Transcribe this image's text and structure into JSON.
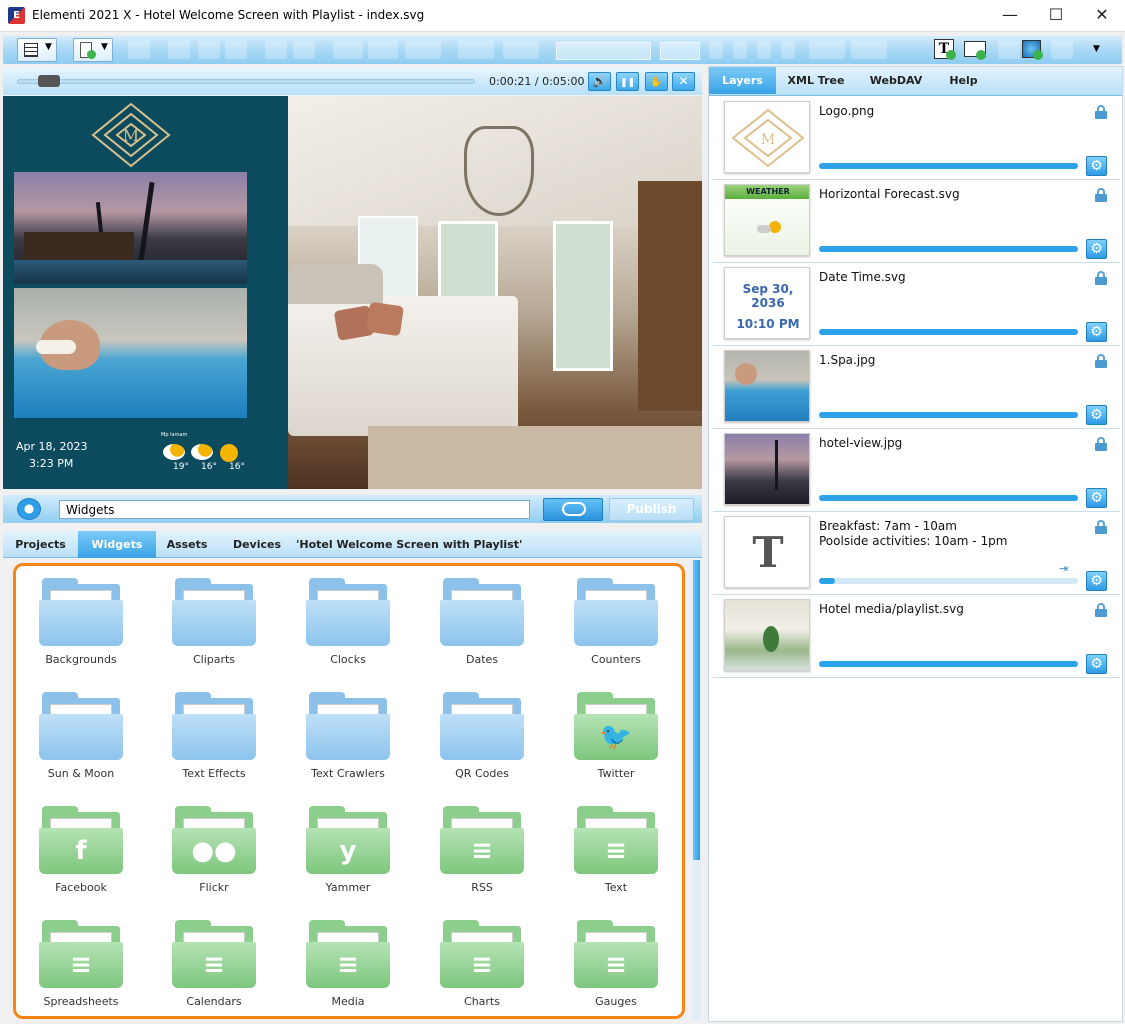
{
  "window": {
    "title": "Elementi 2021 X - Hotel Welcome Screen with Playlist - index.svg",
    "app_icon": "elementi-app-icon",
    "controls": [
      "—",
      "☐",
      "✕"
    ]
  },
  "player": {
    "time": "0:00:21 / 0:05:00",
    "progress_fraction": 0.07,
    "buttons": [
      {
        "name": "volume-icon",
        "glyph": "🔊"
      },
      {
        "name": "pause-icon",
        "glyph": "❚❚"
      },
      {
        "name": "hand-icon",
        "glyph": "✋"
      },
      {
        "name": "close-icon",
        "glyph": "✕"
      }
    ]
  },
  "stage": {
    "date": "Apr 18, 2023",
    "time": "3:23 PM",
    "weather_title": "Mp lamam",
    "temps": [
      "19°",
      "16°",
      "16°"
    ]
  },
  "widget_bar": {
    "search_value": "Widgets",
    "publish_label": "Publish"
  },
  "left_tabs": [
    "Projects",
    "Widgets",
    "Assets",
    "Devices",
    "'Hotel Welcome Screen with Playlist'"
  ],
  "left_active_tab": "Widgets",
  "folders": [
    {
      "label": "Backgrounds",
      "color": "blue",
      "glyph": ""
    },
    {
      "label": "Cliparts",
      "color": "blue",
      "glyph": ""
    },
    {
      "label": "Clocks",
      "color": "blue",
      "glyph": ""
    },
    {
      "label": "Dates",
      "color": "blue",
      "glyph": ""
    },
    {
      "label": "Counters",
      "color": "blue",
      "glyph": ""
    },
    {
      "label": "Sun & Moon",
      "color": "blue",
      "glyph": ""
    },
    {
      "label": "Text Effects",
      "color": "blue",
      "glyph": ""
    },
    {
      "label": "Text Crawlers",
      "color": "blue",
      "glyph": ""
    },
    {
      "label": "QR Codes",
      "color": "blue",
      "glyph": ""
    },
    {
      "label": "Twitter",
      "color": "green",
      "glyph": "🐦"
    },
    {
      "label": "Facebook",
      "color": "green",
      "glyph": "f"
    },
    {
      "label": "Flickr",
      "color": "green",
      "glyph": "●●"
    },
    {
      "label": "Yammer",
      "color": "green",
      "glyph": "y"
    },
    {
      "label": "RSS",
      "color": "green",
      "glyph": "≡"
    },
    {
      "label": "Text",
      "color": "green",
      "glyph": "≡"
    },
    {
      "label": "Spreadsheets",
      "color": "green",
      "glyph": "≡"
    },
    {
      "label": "Calendars",
      "color": "green",
      "glyph": "≡"
    },
    {
      "label": "Media",
      "color": "green",
      "glyph": "≡"
    },
    {
      "label": "Charts",
      "color": "green",
      "glyph": "≡"
    },
    {
      "label": "Gauges",
      "color": "green",
      "glyph": "≡"
    }
  ],
  "right_tabs": [
    "Layers",
    "XML Tree",
    "WebDAV",
    "Help"
  ],
  "right_active_tab": "Layers",
  "layers": [
    {
      "name": "Logo.png",
      "thumb": "logo",
      "progress": 1.0
    },
    {
      "name": "Horizontal Forecast.svg",
      "thumb": "weather",
      "thumb_text": "WEATHER",
      "progress": 1.0
    },
    {
      "name": "Date Time.svg",
      "thumb": "date",
      "thumb_text": "Sep 30, 2036",
      "thumb_text2": "10:10 PM",
      "progress": 1.0
    },
    {
      "name": "1.Spa.jpg",
      "thumb": "spa",
      "progress": 1.0
    },
    {
      "name": "hotel-view.jpg",
      "thumb": "hotel",
      "progress": 1.0
    },
    {
      "name": "Breakfast: 7am - 10am\nPoolside activities: 10am - 1pm",
      "thumb": "text",
      "thumb_text": "T",
      "progress": 0.06
    },
    {
      "name": "Hotel media/playlist.svg",
      "thumb": "playlist",
      "progress": 1.0
    }
  ],
  "colors": {
    "accent": "#2ca2ea",
    "highlight_border": "#f58514",
    "stage_panel": "#0c4a5e",
    "folder_blue": "#8cc2ea",
    "folder_green": "#8ccf8c"
  }
}
